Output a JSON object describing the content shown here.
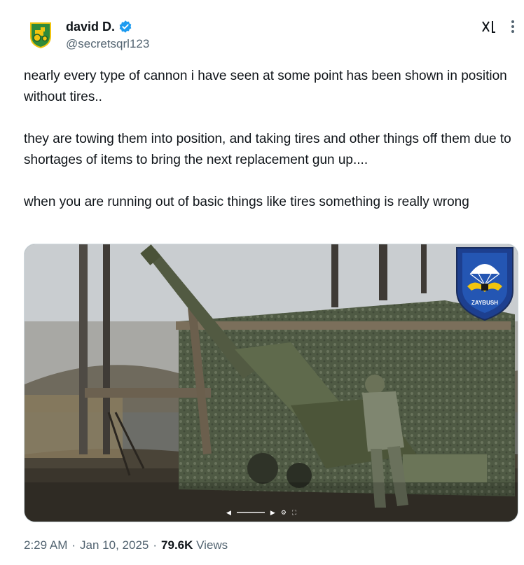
{
  "author": {
    "display_name": "david D.",
    "handle": "@secretsqrl123",
    "avatar_icon": "tractor-crest-icon",
    "verified_icon": "verified-badge-icon",
    "verified_color": "#1d9bf0"
  },
  "header": {
    "grok_icon": "grok-icon",
    "more_icon": "more-options-icon"
  },
  "tweet": {
    "paragraphs": [
      "nearly every type of cannon i have seen at some point has been shown in position without tires..",
      "they are towing them into position, and taking tires and other things off them due to shortages of items to bring the next replacement gun up....",
      "when you are running out of basic things like tires something is really wrong"
    ]
  },
  "media": {
    "type": "video",
    "description_icon": "howitzer-video-thumbnail",
    "badge_text": "ZAYBUSH",
    "controls_icons": [
      "volume-icon",
      "play-icon",
      "settings-icon",
      "fullscreen-icon"
    ]
  },
  "meta": {
    "time": "2:29 AM",
    "date": "Jan 10, 2025",
    "views_count": "79.6K",
    "views_label": "Views",
    "separator": "·"
  },
  "colors": {
    "text_primary": "#0f1419",
    "text_secondary": "#536471",
    "border": "#cfd9de"
  }
}
